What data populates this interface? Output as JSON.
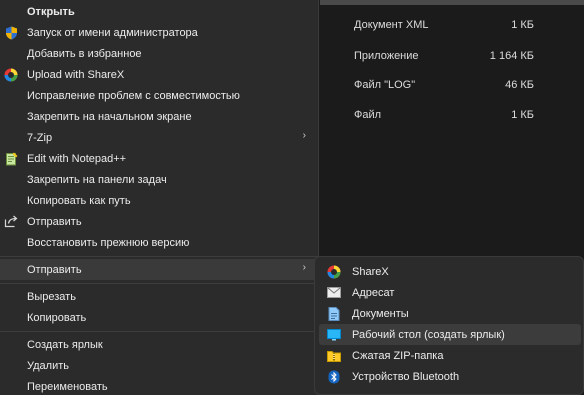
{
  "menu": {
    "items": [
      {
        "label": "Открыть",
        "icon": "none"
      },
      {
        "label": "Запуск от имени администратора",
        "icon": "shield-icon"
      },
      {
        "label": "Добавить в избранное",
        "icon": "none"
      },
      {
        "label": "Upload with ShareX",
        "icon": "sharex-icon"
      },
      {
        "label": "Исправление проблем с совместимостью",
        "icon": "none"
      },
      {
        "label": "Закрепить на начальном экране",
        "icon": "none"
      },
      {
        "label": "7-Zip",
        "icon": "none",
        "submenu_arrow": "›"
      },
      {
        "label": "Edit with Notepad++",
        "icon": "notepad-icon"
      },
      {
        "label": "Закрепить на панели задач",
        "icon": "none"
      },
      {
        "label": "Копировать как путь",
        "icon": "none"
      },
      {
        "label": "Отправить",
        "icon": "share-icon"
      },
      {
        "label": "Восстановить прежнюю версию",
        "icon": "none"
      },
      {
        "label": "Отправить",
        "icon": "none",
        "submenu_arrow": "›"
      },
      {
        "label": "Вырезать",
        "icon": "none"
      },
      {
        "label": "Копировать",
        "icon": "none"
      },
      {
        "label": "Создать ярлык",
        "icon": "none"
      },
      {
        "label": "Удалить",
        "icon": "none"
      },
      {
        "label": "Переименовать",
        "icon": "none"
      }
    ]
  },
  "submenu": {
    "items": [
      {
        "label": "ShareX",
        "icon": "sharex-icon"
      },
      {
        "label": "Адресат",
        "icon": "mail-icon"
      },
      {
        "label": "Документы",
        "icon": "documents-icon"
      },
      {
        "label": "Рабочий стол (создать ярлык)",
        "icon": "desktop-icon"
      },
      {
        "label": "Сжатая ZIP-папка",
        "icon": "zip-folder-icon"
      },
      {
        "label": "Устройство Bluetooth",
        "icon": "bluetooth-icon"
      }
    ]
  },
  "files": [
    {
      "type": "Документ XML",
      "size": "1 КБ"
    },
    {
      "type": "Приложение",
      "size": "1 164 КБ"
    },
    {
      "type": "Файл \"LOG\"",
      "size": "46 КБ"
    },
    {
      "type": "Файл",
      "size": "1 КБ"
    }
  ],
  "colors": {
    "menu_bg": "#2b2b2b",
    "hover_bg": "#3a3a3a",
    "pane_bg": "#1b1b1b",
    "text": "#ececec"
  }
}
